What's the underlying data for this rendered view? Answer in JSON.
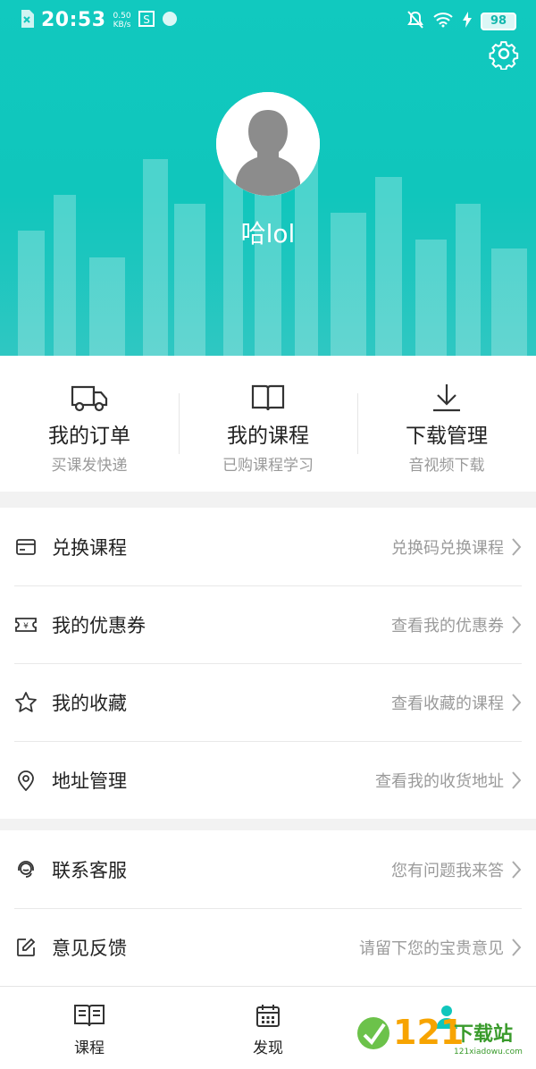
{
  "status_bar": {
    "time": "20:53",
    "speed_value": "0.50",
    "speed_unit": "KB/s",
    "battery": "98"
  },
  "profile": {
    "username": "哈lol"
  },
  "quick_actions": [
    {
      "title": "我的订单",
      "subtitle": "买课发快递",
      "icon": "truck-icon"
    },
    {
      "title": "我的课程",
      "subtitle": "已购课程学习",
      "icon": "book-icon"
    },
    {
      "title": "下载管理",
      "subtitle": "音视频下载",
      "icon": "download-icon"
    }
  ],
  "menu_group_1": [
    {
      "title": "兑换课程",
      "subtitle": "兑换码兑换课程",
      "icon": "card-icon"
    },
    {
      "title": "我的优惠券",
      "subtitle": "查看我的优惠券",
      "icon": "coupon-icon"
    },
    {
      "title": "我的收藏",
      "subtitle": "查看收藏的课程",
      "icon": "star-icon"
    },
    {
      "title": "地址管理",
      "subtitle": "查看我的收货地址",
      "icon": "location-icon"
    }
  ],
  "menu_group_2": [
    {
      "title": "联系客服",
      "subtitle": "您有问题我来答",
      "icon": "headset-icon"
    },
    {
      "title": "意见反馈",
      "subtitle": "请留下您的宝贵意见",
      "icon": "edit-icon"
    }
  ],
  "tabbar": [
    {
      "label": "课程",
      "icon": "course-icon"
    },
    {
      "label": "发现",
      "icon": "calendar-icon"
    },
    {
      "label": "",
      "icon": "me-icon"
    }
  ],
  "watermark": {
    "number": "121",
    "text": "下载站",
    "url": "121xiadowu.com"
  },
  "colors": {
    "accent": "#10c6bc",
    "text_primary": "#222222",
    "text_secondary": "#9a9a9a"
  }
}
